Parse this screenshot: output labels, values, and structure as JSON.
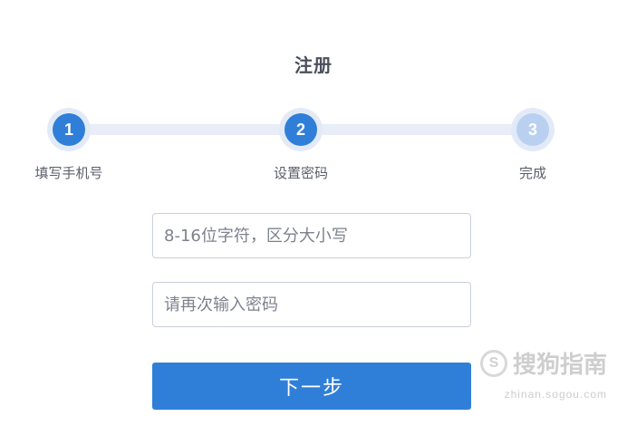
{
  "page": {
    "title": "注册"
  },
  "steps": [
    {
      "number": "1",
      "label": "填写手机号",
      "state": "completed"
    },
    {
      "number": "2",
      "label": "设置密码",
      "state": "active"
    },
    {
      "number": "3",
      "label": "完成",
      "state": "pending"
    }
  ],
  "form": {
    "password_placeholder": "8-16位字符，区分大小写",
    "confirm_placeholder": "请再次输入密码",
    "next_label": "下一步"
  },
  "watermark": {
    "logo": "S",
    "text": "搜狗指南",
    "url": "zhinan.sogou.com"
  },
  "colors": {
    "accent": "#2f7fd8",
    "accent_light": "#b9d0f0",
    "track": "#e8edf7"
  }
}
